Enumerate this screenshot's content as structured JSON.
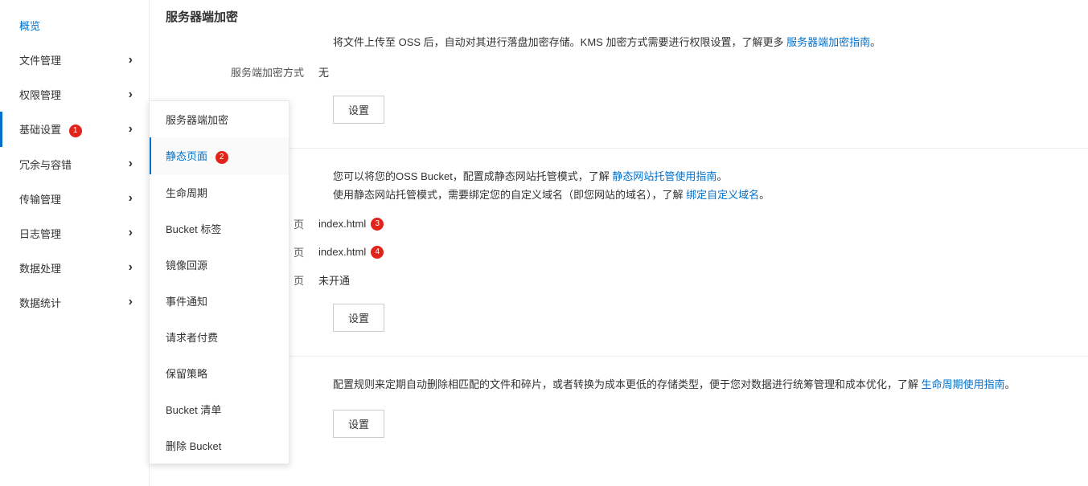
{
  "sidebar": {
    "items": [
      {
        "label": "概览",
        "active_link": true,
        "has_chev": false
      },
      {
        "label": "文件管理",
        "has_chev": true
      },
      {
        "label": "权限管理",
        "has_chev": true
      },
      {
        "label": "基础设置",
        "has_chev": true,
        "badge": "1",
        "selected": true
      },
      {
        "label": "冗余与容错",
        "has_chev": true
      },
      {
        "label": "传输管理",
        "has_chev": true
      },
      {
        "label": "日志管理",
        "has_chev": true
      },
      {
        "label": "数据处理",
        "has_chev": true
      },
      {
        "label": "数据统计",
        "has_chev": true
      }
    ]
  },
  "submenu": {
    "items": [
      {
        "label": "服务器端加密"
      },
      {
        "label": "静态页面",
        "badge": "2",
        "active": true
      },
      {
        "label": "生命周期"
      },
      {
        "label": "Bucket 标签"
      },
      {
        "label": "镜像回源"
      },
      {
        "label": "事件通知"
      },
      {
        "label": "请求者付费"
      },
      {
        "label": "保留策略"
      },
      {
        "label": "Bucket 清单"
      },
      {
        "label": "删除 Bucket"
      }
    ]
  },
  "sections": {
    "encryption": {
      "title": "服务器端加密",
      "desc_prefix": "将文件上传至 OSS 后，自动对其进行落盘加密存储。KMS 加密方式需要进行权限设置，了解更多 ",
      "link_text": "服务器端加密指南",
      "desc_suffix": "。",
      "method_label": "服务端加密方式",
      "method_value": "无",
      "button": "设置"
    },
    "static": {
      "desc1_prefix": "您可以将您的OSS Bucket，配置成静态网站托管模式，了解 ",
      "desc1_link": "静态网站托管使用指南",
      "desc1_suffix": "。",
      "desc2_prefix": "使用静态网站托管模式，需要绑定您的自定义域名（即您网站的域名），了解 ",
      "desc2_link": "绑定自定义域名",
      "desc2_suffix": "。",
      "rows": [
        {
          "label": "页",
          "value": "index.html",
          "badge": "3"
        },
        {
          "label": "页",
          "value": "index.html",
          "badge": "4"
        },
        {
          "label": "页",
          "value": "未开通"
        }
      ],
      "button": "设置"
    },
    "lifecycle": {
      "desc_prefix": "配置规则来定期自动删除相匹配的文件和碎片，或者转换为成本更低的存储类型，便于您对数据进行统筹管理和成本优化，了解 ",
      "link_text": "生命周期使用指南",
      "desc_suffix": "。",
      "button": "设置"
    }
  }
}
